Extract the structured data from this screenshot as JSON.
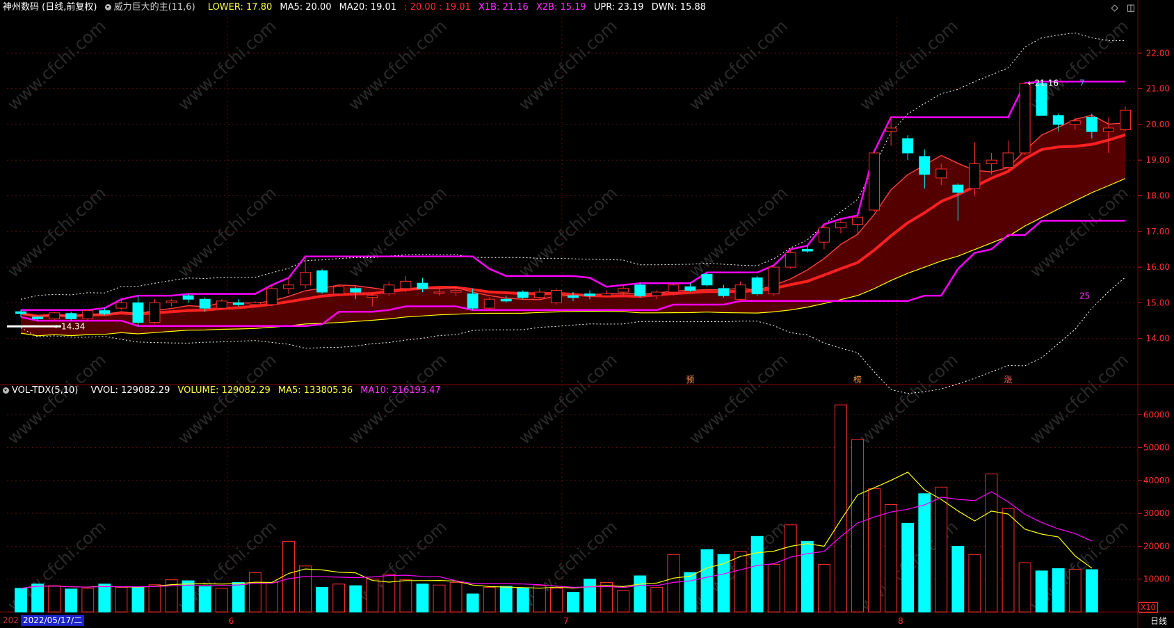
{
  "header_top": {
    "stock": "神州数码 (日线,前复权)",
    "indicator": "威力巨大的主(11,6)",
    "lower": "LOWER: 17.80",
    "ma5": "MA5: 20.00",
    "ma20": "MA20: 19.01",
    "extra": ": 20.00 : 19.01",
    "x1b": "X1B: 21.16",
    "x2b": "X2B: 15.19",
    "upr": "UPR: 23.19",
    "dwn": "DWN: 15.88"
  },
  "header_vol": {
    "indicator": "VOL-TDX(5,10)",
    "vvol": "VVOL: 129082.29",
    "volume": "VOLUME: 129082.29",
    "ma5": "MA5: 133805.36",
    "ma10": "MA10: 216193.47"
  },
  "icons": {
    "diamond": "◇",
    "window": "◫"
  },
  "price_axis": [
    "22.00",
    "21.00",
    "20.00",
    "19.00",
    "18.00",
    "17.00",
    "16.00",
    "15.00",
    "14.00"
  ],
  "vol_axis": [
    "60000",
    "50000",
    "40000",
    "30000",
    "20000",
    "10000"
  ],
  "x_axis": {
    "prefix": "202",
    "date": "2022/05/17/二",
    "months": [
      "6",
      "7",
      "8"
    ],
    "period": "日线",
    "scale": "X10"
  },
  "annotations": {
    "low": "←14.34",
    "high": "←21.16",
    "right_top": "7",
    "right_low": "25",
    "markers": [
      "预",
      "榜",
      "涨"
    ]
  },
  "watermark": "www.cfchi.com",
  "colors": {
    "up": "#ff3030",
    "down": "#00ffff",
    "magenta": "#ff00ff",
    "yellow": "#ffff00",
    "band": "#5a0000"
  },
  "chart_data": {
    "type": "candlestick",
    "candles": [
      [
        14.75,
        14.8,
        14.6,
        14.7
      ],
      [
        14.6,
        14.62,
        14.5,
        14.55
      ],
      [
        14.55,
        14.75,
        14.5,
        14.72
      ],
      [
        14.7,
        14.75,
        14.5,
        14.55
      ],
      [
        14.55,
        14.8,
        14.5,
        14.78
      ],
      [
        14.78,
        14.85,
        14.65,
        14.7
      ],
      [
        14.85,
        15.1,
        14.8,
        15.0
      ],
      [
        15.0,
        15.2,
        14.35,
        14.45
      ],
      [
        14.45,
        15.1,
        14.4,
        15.0
      ],
      [
        15.0,
        15.1,
        14.9,
        15.05
      ],
      [
        15.2,
        15.25,
        15.0,
        15.1
      ],
      [
        15.1,
        15.15,
        14.75,
        14.85
      ],
      [
        14.85,
        15.1,
        14.8,
        15.05
      ],
      [
        15.0,
        15.1,
        14.9,
        14.95
      ],
      [
        14.95,
        15.05,
        14.9,
        15.0
      ],
      [
        14.95,
        15.5,
        14.9,
        15.4
      ],
      [
        15.4,
        15.7,
        15.25,
        15.5
      ],
      [
        15.5,
        16.3,
        15.4,
        15.85
      ],
      [
        15.9,
        15.95,
        15.25,
        15.3
      ],
      [
        15.25,
        15.5,
        15.2,
        15.45
      ],
      [
        15.4,
        15.45,
        15.1,
        15.3
      ],
      [
        15.15,
        15.3,
        14.9,
        15.2
      ],
      [
        15.25,
        15.6,
        15.2,
        15.5
      ],
      [
        15.4,
        15.75,
        15.3,
        15.6
      ],
      [
        15.55,
        15.7,
        15.3,
        15.4
      ],
      [
        15.3,
        15.45,
        15.2,
        15.3
      ],
      [
        15.3,
        15.4,
        15.2,
        15.35
      ],
      [
        15.25,
        15.4,
        14.8,
        14.85
      ],
      [
        14.85,
        15.15,
        14.8,
        15.1
      ],
      [
        15.1,
        15.2,
        15.0,
        15.05
      ],
      [
        15.3,
        15.35,
        15.1,
        15.15
      ],
      [
        15.15,
        15.4,
        15.1,
        15.3
      ],
      [
        15.0,
        15.4,
        14.95,
        15.35
      ],
      [
        15.2,
        15.3,
        15.05,
        15.15
      ],
      [
        15.25,
        15.35,
        15.1,
        15.2
      ],
      [
        15.2,
        15.35,
        15.15,
        15.25
      ],
      [
        15.3,
        15.5,
        15.2,
        15.4
      ],
      [
        15.5,
        15.55,
        15.15,
        15.2
      ],
      [
        15.2,
        15.35,
        15.1,
        15.3
      ],
      [
        15.3,
        15.55,
        15.2,
        15.5
      ],
      [
        15.45,
        15.55,
        15.3,
        15.35
      ],
      [
        15.8,
        15.85,
        15.45,
        15.5
      ],
      [
        15.4,
        15.5,
        15.15,
        15.2
      ],
      [
        15.1,
        15.6,
        15.05,
        15.5
      ],
      [
        15.7,
        15.75,
        15.2,
        15.25
      ],
      [
        15.25,
        16.05,
        15.2,
        16.0
      ],
      [
        16.0,
        16.5,
        15.95,
        16.4
      ],
      [
        16.5,
        16.6,
        16.4,
        16.45
      ],
      [
        16.7,
        17.2,
        16.5,
        17.1
      ],
      [
        17.1,
        17.35,
        16.95,
        17.25
      ],
      [
        17.2,
        17.45,
        16.9,
        17.4
      ],
      [
        17.6,
        19.25,
        17.55,
        19.2
      ],
      [
        19.8,
        20.2,
        19.4,
        19.9
      ],
      [
        19.6,
        19.7,
        19.0,
        19.2
      ],
      [
        19.1,
        19.3,
        18.2,
        18.6
      ],
      [
        18.5,
        18.9,
        18.3,
        18.75
      ],
      [
        18.3,
        18.35,
        17.3,
        18.1
      ],
      [
        18.2,
        19.5,
        18.0,
        18.9
      ],
      [
        18.9,
        19.2,
        18.6,
        19.0
      ],
      [
        18.8,
        19.55,
        18.7,
        19.2
      ],
      [
        19.2,
        21.16,
        19.15,
        21.15
      ],
      [
        21.15,
        21.2,
        20.3,
        20.25
      ],
      [
        20.25,
        20.3,
        19.8,
        20.0
      ],
      [
        20.0,
        20.2,
        19.85,
        20.1
      ],
      [
        20.2,
        20.3,
        19.6,
        19.8
      ],
      [
        19.8,
        20.2,
        19.2,
        19.9
      ],
      [
        19.85,
        20.5,
        19.8,
        20.4
      ]
    ],
    "volume": [
      7200,
      8500,
      8000,
      7000,
      7200,
      8500,
      7500,
      7600,
      8300,
      9800,
      9500,
      7700,
      7200,
      9000,
      12000,
      9000,
      21500,
      14000,
      7500,
      8500,
      8000,
      10000,
      11500,
      9800,
      8500,
      8200,
      9000,
      5500,
      7500,
      7800,
      7400,
      8000,
      7200,
      6000,
      10000,
      9000,
      6500,
      11000,
      7500,
      17500,
      12000,
      19000,
      17500,
      18500,
      23000,
      14500,
      26500,
      21500,
      14500,
      63000,
      52500,
      37500,
      32700,
      27000,
      36000,
      38000,
      20000,
      17500,
      42000,
      31500,
      15000,
      12500,
      13200,
      13000,
      12900
    ],
    "ylim": [
      13.0,
      23.0
    ],
    "vol_ylim": [
      0,
      66000
    ]
  }
}
